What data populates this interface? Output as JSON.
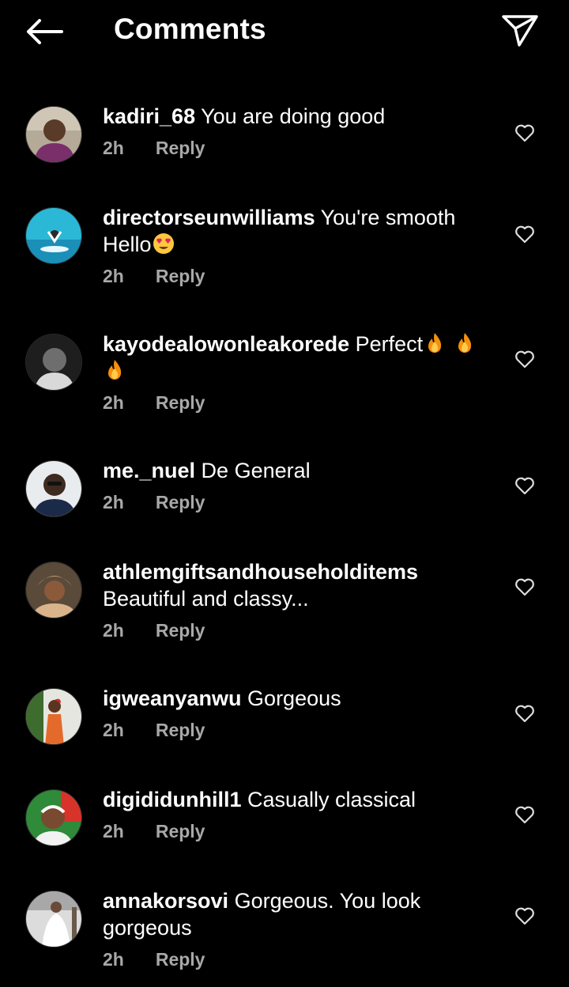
{
  "header": {
    "title": "Comments"
  },
  "comments": [
    {
      "username": "kadiri_68",
      "text": " You are doing good",
      "time": "2h",
      "reply": "Reply"
    },
    {
      "username": "directorseunwilliams",
      "text": " You're smooth Hello",
      "time": "2h",
      "reply": "Reply"
    },
    {
      "username": "kayodealowonleakorede",
      "text": " Perfect",
      "time": "2h",
      "reply": "Reply"
    },
    {
      "username": "me._nuel",
      "text": " De General",
      "time": "2h",
      "reply": "Reply"
    },
    {
      "username": "athlemgiftsandhouseholditems",
      "text": " Beautiful and classy...",
      "time": "2h",
      "reply": "Reply"
    },
    {
      "username": "igweanyanwu",
      "text": " Gorgeous",
      "time": "2h",
      "reply": "Reply"
    },
    {
      "username": "digididunhill1",
      "text": " Casually classical",
      "time": "2h",
      "reply": "Reply"
    },
    {
      "username": "annakorsovi",
      "text": " Gorgeous. You look gorgeous",
      "time": "2h",
      "reply": "Reply"
    }
  ],
  "icons": {
    "back": "arrow-left-icon",
    "share": "paper-plane-icon",
    "like": "heart-outline-icon",
    "emoji_heart_eyes": "heart-eyes-emoji",
    "emoji_fire": "fire-emoji"
  },
  "colors": {
    "background": "#000000",
    "text": "#ffffff",
    "meta": "#a8a8a8"
  }
}
